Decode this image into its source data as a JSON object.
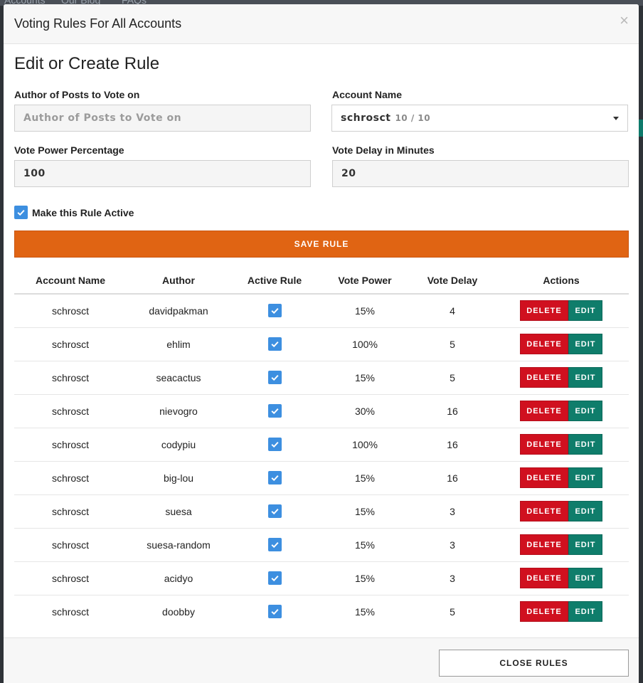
{
  "background_nav": {
    "items": [
      "Accounts",
      "Our Blog",
      "FAQs"
    ]
  },
  "modal": {
    "title": "Voting Rules For All Accounts",
    "close_symbol": "×",
    "section_title": "Edit or Create Rule",
    "form": {
      "author_label": "Author of Posts to Vote on",
      "author_placeholder": "Author of Posts to Vote on",
      "author_value": "",
      "account_label": "Account Name",
      "account_value": "schrosct",
      "account_sub": "10 / 10",
      "power_label": "Vote Power Percentage",
      "power_value": "100",
      "delay_label": "Vote Delay in Minutes",
      "delay_value": "20",
      "active_label": "Make this Rule Active",
      "active_checked": true
    },
    "save_label": "SAVE RULE",
    "table": {
      "headers": [
        "Account Name",
        "Author",
        "Active Rule",
        "Vote Power",
        "Vote Delay",
        "Actions"
      ],
      "delete_label": "DELETE",
      "edit_label": "EDIT",
      "rows": [
        {
          "account": "schrosct",
          "author": "davidpakman",
          "active": true,
          "power": "15%",
          "delay": "4"
        },
        {
          "account": "schrosct",
          "author": "ehlim",
          "active": true,
          "power": "100%",
          "delay": "5"
        },
        {
          "account": "schrosct",
          "author": "seacactus",
          "active": true,
          "power": "15%",
          "delay": "5"
        },
        {
          "account": "schrosct",
          "author": "nievogro",
          "active": true,
          "power": "30%",
          "delay": "16"
        },
        {
          "account": "schrosct",
          "author": "codypiu",
          "active": true,
          "power": "100%",
          "delay": "16"
        },
        {
          "account": "schrosct",
          "author": "big-lou",
          "active": true,
          "power": "15%",
          "delay": "16"
        },
        {
          "account": "schrosct",
          "author": "suesa",
          "active": true,
          "power": "15%",
          "delay": "3"
        },
        {
          "account": "schrosct",
          "author": "suesa-random",
          "active": true,
          "power": "15%",
          "delay": "3"
        },
        {
          "account": "schrosct",
          "author": "acidyo",
          "active": true,
          "power": "15%",
          "delay": "3"
        },
        {
          "account": "schrosct",
          "author": "doobby",
          "active": true,
          "power": "15%",
          "delay": "5"
        }
      ]
    },
    "close_rules_label": "CLOSE RULES"
  },
  "colors": {
    "save": "#e06413",
    "delete": "#d0101f",
    "edit": "#0f7d6b",
    "checkbox": "#3d8fe0"
  },
  "icons": {
    "checkbox": "check-icon",
    "dropdown": "caret-down-icon",
    "close": "close-icon"
  }
}
